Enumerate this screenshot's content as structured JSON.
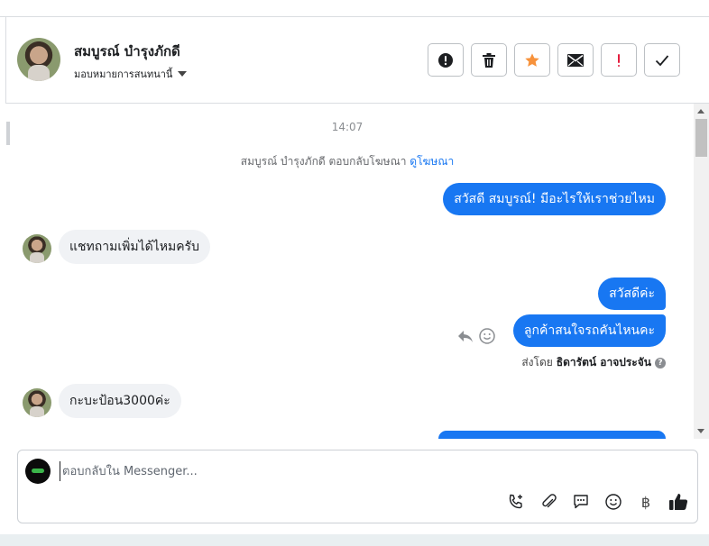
{
  "header": {
    "contact_name": "สมบูรณ์ บำรุงภักดี",
    "assign_label": "มอบหมายการสนทนานี้",
    "actions": [
      {
        "icon": "alert-circle-icon"
      },
      {
        "icon": "trash-icon"
      },
      {
        "icon": "star-icon",
        "color": "#f7923b"
      },
      {
        "icon": "envelope-icon"
      },
      {
        "icon": "exclamation-icon",
        "color": "#e41e3f"
      },
      {
        "icon": "checkmark-icon"
      }
    ]
  },
  "chat": {
    "timestamp": "14:07",
    "ad_note": {
      "text": "สมบูรณ์ บำรุงภักดี ตอบกลับโฆษณา",
      "link": "ดูโฆษณา"
    },
    "messages": [
      {
        "direction": "out",
        "text": "สวัสดี สมบูรณ์! มีอะไรให้เราช่วยไหม"
      },
      {
        "direction": "in",
        "text": "แชทถามเพิ่มได้ไหมครับ"
      },
      {
        "direction": "out",
        "text": "สวัสดีค่ะ"
      },
      {
        "direction": "out",
        "text": "ลูกค้าสนใจรถคันไหนคะ"
      },
      {
        "direction": "in",
        "text": "กะบะป้อน3000ค่ะ"
      }
    ],
    "sent_by": {
      "prefix": "ส่งโดย",
      "name": "ธิดารัตน์ อาจประจัน"
    }
  },
  "composer": {
    "placeholder": "ตอบกลับใน Messenger...",
    "value": "",
    "baht_symbol": "฿",
    "tools": [
      "phone-add-icon",
      "paperclip-icon",
      "saved-reply-icon",
      "emoji-icon",
      "baht-icon",
      "thumbs-up-icon"
    ]
  },
  "colors": {
    "accent": "#1877f2",
    "incoming_bubble": "#f0f2f5"
  }
}
